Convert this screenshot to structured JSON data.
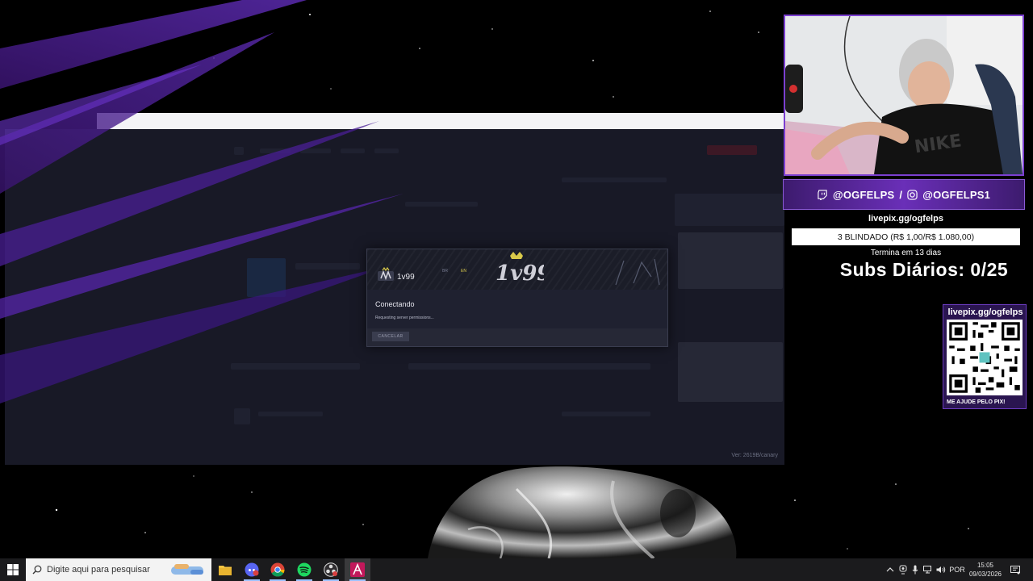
{
  "dialog": {
    "brand": "1v99",
    "lang_en": "EN",
    "lang_pt": "BR",
    "status_title": "Conectando",
    "status_sub": "Requesting server permissions...",
    "cancel_label": "CANCELAR"
  },
  "app": {
    "version": "Ver: 2619B/canary"
  },
  "overlay": {
    "twitch_handle": "@OGFELPS",
    "separator": "/",
    "instagram_handle": "@OGFELPS1",
    "livepix_url": "livepix.gg/ogfelps",
    "goal_text": "3 BLINDADO (R$ 1,00/R$ 1.080,00)",
    "goal_progress": 0.001,
    "ends_text": "Termina em 13 dias",
    "subs_text": "Subs Diários: 0/25",
    "qr_label_top": "livepix.gg/ogfelps",
    "qr_label_bottom": "ME AJUDE PELO PIX!"
  },
  "taskbar": {
    "search_placeholder": "Digite aqui para pesquisar",
    "apps": [
      "file-explorer-icon",
      "discord-icon",
      "chrome-icon",
      "spotify-icon",
      "obs-icon",
      "alt-v-app-icon"
    ],
    "language": "POR",
    "time": "15:05",
    "date": "09/03/2026"
  },
  "colors": {
    "accent_purple": "#6a2fb8",
    "background": "#000000",
    "taskbar": "#1b1b1d"
  }
}
